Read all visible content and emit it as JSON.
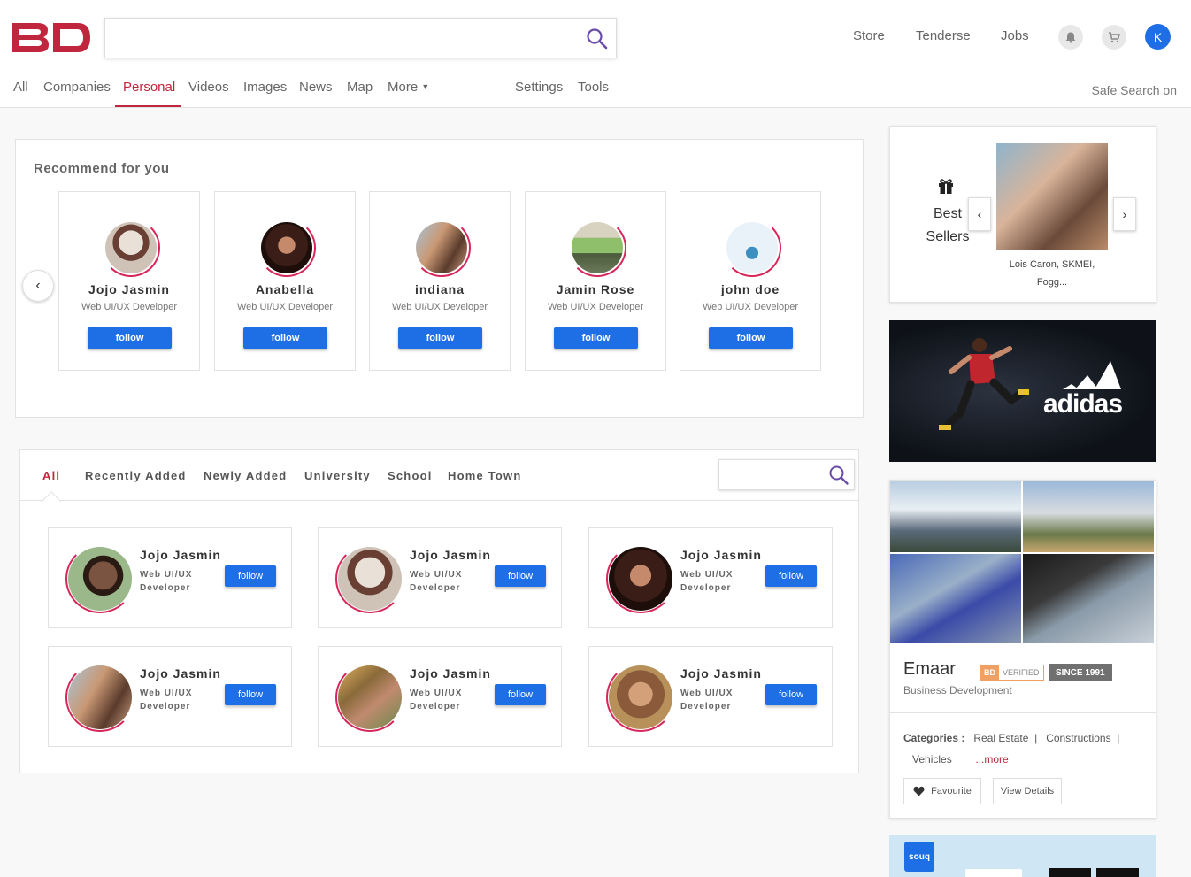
{
  "logo": {
    "text": "BD"
  },
  "header": {
    "links": [
      "Store",
      "Tenderse",
      "Jobs"
    ],
    "avatar_letter": "K"
  },
  "nav": {
    "items": [
      "All",
      "Companies",
      "Personal",
      "Videos",
      "Images",
      "News",
      "Map",
      "More"
    ],
    "active": "Personal",
    "right_items": [
      "Settings",
      "Tools"
    ],
    "safe_search": "Safe Search on"
  },
  "recommend": {
    "title": "Recommend for you",
    "cards": [
      {
        "name": "Jojo Jasmin",
        "role": "Web UI/UX Developer",
        "button": "follow"
      },
      {
        "name": "Anabella",
        "role": "Web UI/UX Developer",
        "button": "follow"
      },
      {
        "name": "indiana",
        "role": "Web UI/UX Developer",
        "button": "follow"
      },
      {
        "name": "Jamin Rose",
        "role": "Web UI/UX Developer",
        "button": "follow"
      },
      {
        "name": "john doe",
        "role": "Web UI/UX Developer",
        "button": "follow"
      }
    ]
  },
  "friends": {
    "tabs": [
      "All",
      "Recently Added",
      "Newly Added",
      "University",
      "School",
      "Home Town"
    ],
    "active_tab": "All",
    "cards": [
      {
        "name": "Jojo Jasmin",
        "role": "Web UI/UX Developer",
        "button": "follow"
      },
      {
        "name": "Jojo Jasmin",
        "role": "Web UI/UX Developer",
        "button": "follow"
      },
      {
        "name": "Jojo Jasmin",
        "role": "Web UI/UX Developer",
        "button": "follow"
      },
      {
        "name": "Jojo Jasmin",
        "role": "Web UI/UX Developer",
        "button": "follow"
      },
      {
        "name": "Jojo Jasmin",
        "role": "Web UI/UX Developer",
        "button": "follow"
      },
      {
        "name": "Jojo Jasmin",
        "role": "Web UI/UX Developer",
        "button": "follow"
      }
    ]
  },
  "best_sellers": {
    "label": "Best Sellers",
    "caption": "Lois Caron, SKMEI, Fogg..."
  },
  "ad": {
    "brand": "adidas"
  },
  "emaar": {
    "name": "Emaar",
    "badge_bd": "BD",
    "badge_verified": "VERIFIED",
    "since": "SINCE 1991",
    "subtitle": "Business Development",
    "categories_label": "Categories :",
    "categories": [
      "Real Estate",
      "Constructions",
      "Vehicles"
    ],
    "more": "...more",
    "favourite": "Favourite",
    "view_details": "View Details"
  },
  "souq": {
    "logo": "souq"
  },
  "colors": {
    "accent": "#c0263d",
    "primary": "#1e6fe6"
  }
}
